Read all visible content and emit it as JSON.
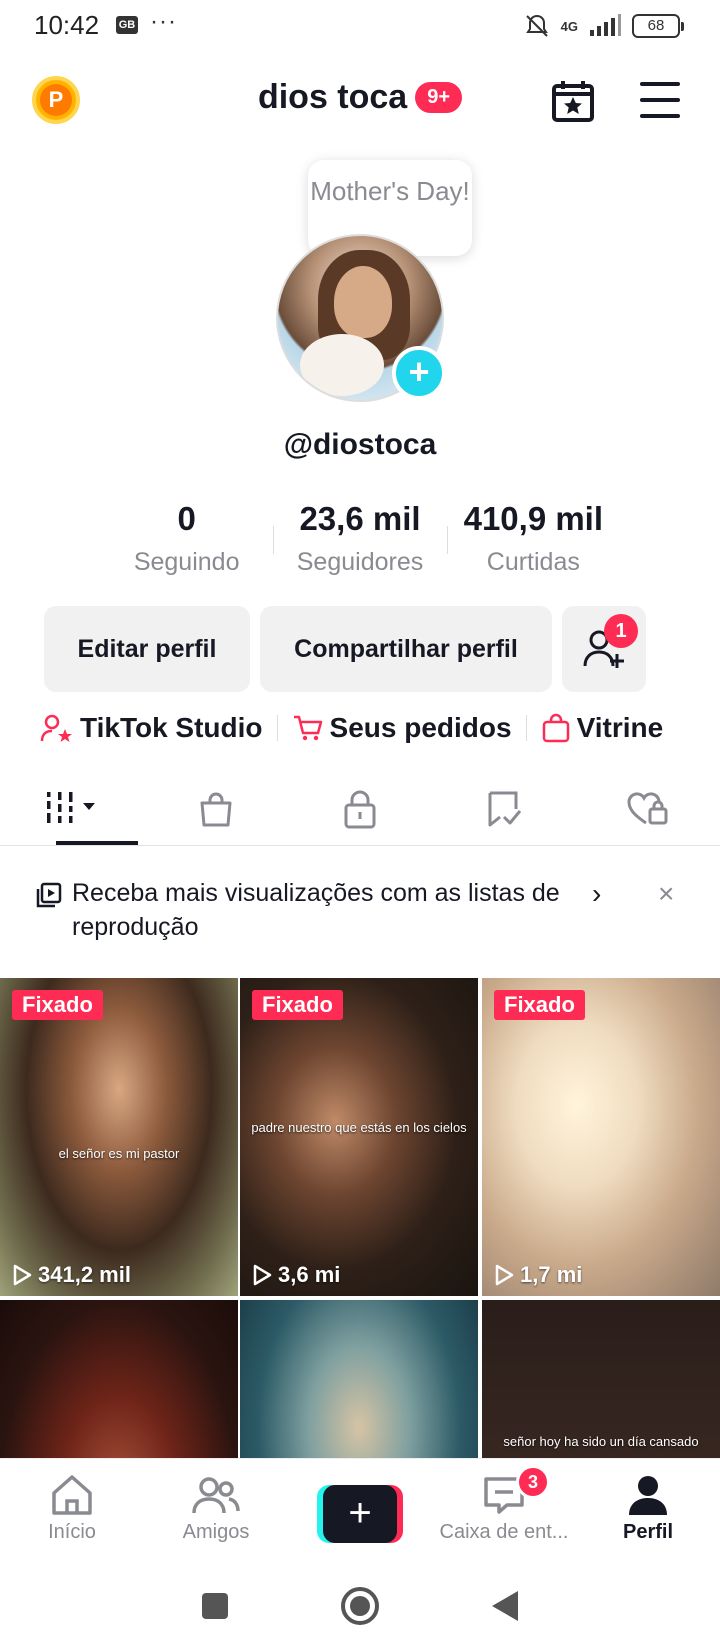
{
  "status_bar": {
    "time": "10:42",
    "sim_label": "GB",
    "more": "···",
    "network": "4G",
    "battery": "68"
  },
  "header": {
    "title": "dios toca",
    "notification_badge": "9+",
    "coin_letter": "P"
  },
  "profile": {
    "bubble_text": "Mother's Day!",
    "handle": "@diostoca",
    "add_symbol": "+",
    "stats": [
      {
        "value": "0",
        "label": "Seguindo"
      },
      {
        "value": "23,6 mil",
        "label": "Seguidores"
      },
      {
        "value": "410,9 mil",
        "label": "Curtidas"
      }
    ]
  },
  "actions": {
    "edit": "Editar perfil",
    "share": "Compartilhar perfil",
    "add_friend_badge": "1"
  },
  "links": [
    {
      "label": "TikTok Studio",
      "icon": "person-star-icon"
    },
    {
      "label": "Seus pedidos",
      "icon": "cart-icon"
    },
    {
      "label": "Vitrine",
      "icon": "bag-icon"
    }
  ],
  "tabs": [
    "videos-grid-icon",
    "shop-bag-icon",
    "lock-icon",
    "tagged-icon",
    "liked-heart-icon"
  ],
  "promo": {
    "text": "Receba mais visualizações com as listas de reprodução",
    "chevron": "›",
    "close": "×"
  },
  "videos": [
    {
      "pinned": "Fixado",
      "caption": "el señor es mi pastor",
      "views": "341,2 mil"
    },
    {
      "pinned": "Fixado",
      "caption": "padre nuestro que estás en los cielos",
      "views": "3,6 mi"
    },
    {
      "pinned": "Fixado",
      "caption": "",
      "views": "1,7 mi"
    },
    {
      "pinned": "",
      "caption": "",
      "views": ""
    },
    {
      "pinned": "",
      "caption": "",
      "views": ""
    },
    {
      "pinned": "",
      "caption": "señor hoy ha sido un día cansado",
      "views": ""
    }
  ],
  "bottom_nav": {
    "home": "Início",
    "friends": "Amigos",
    "create": "+",
    "inbox": "Caixa de ent...",
    "inbox_badge": "3",
    "profile": "Perfil"
  },
  "colors": {
    "accent": "#fe2c55",
    "cyan": "#20d5ec",
    "text": "#161823",
    "muted": "#8a8b91"
  }
}
